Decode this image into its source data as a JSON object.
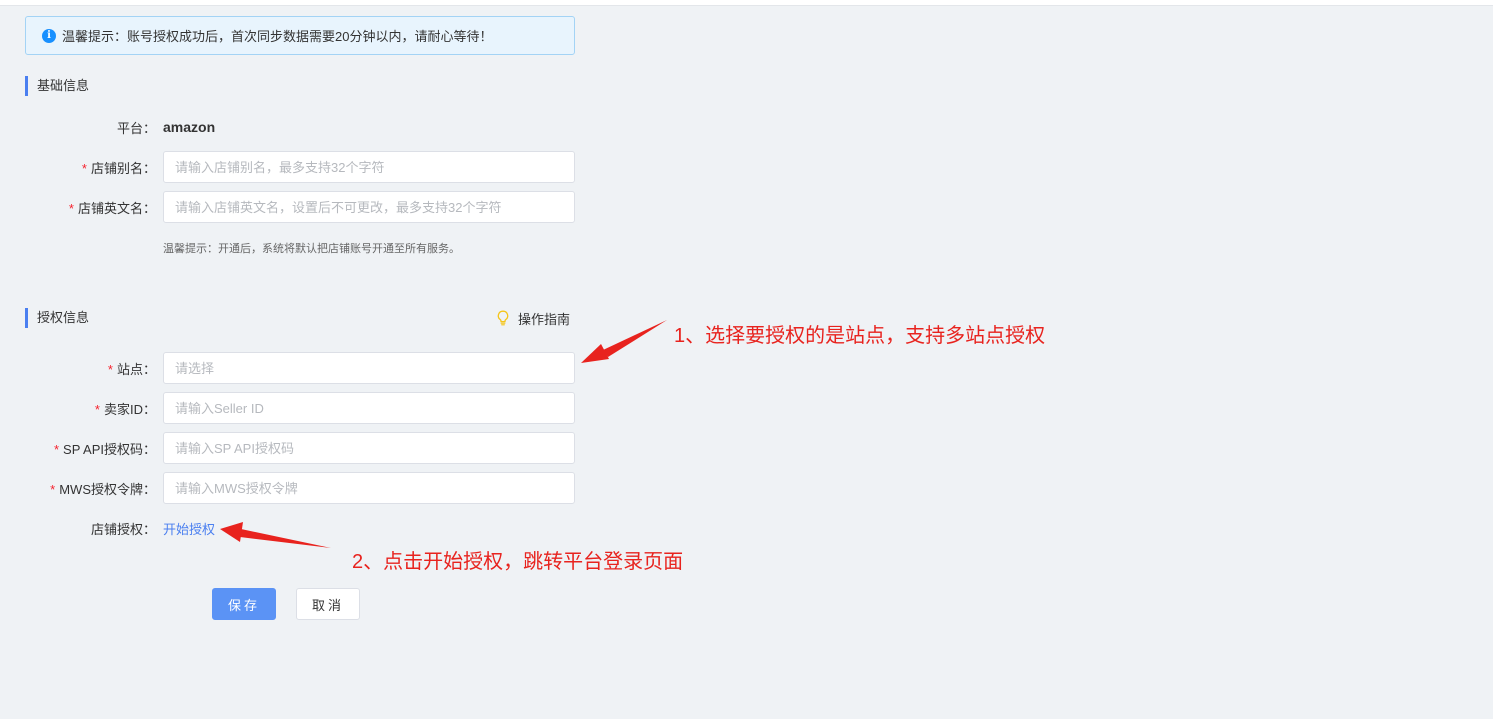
{
  "notice": {
    "text": "温馨提示：账号授权成功后，首次同步数据需要20分钟以内，请耐心等待！"
  },
  "basic": {
    "title": "基础信息",
    "platform_label": "平台：",
    "platform_value": "amazon",
    "shop_alias_label": "店铺别名：",
    "shop_alias_placeholder": "请输入店铺别名，最多支持32个字符",
    "shop_en_label": "店铺英文名：",
    "shop_en_placeholder": "请输入店铺英文名，设置后不可更改，最多支持32个字符",
    "hint": "温馨提示：开通后，系统将默认把店铺账号开通至所有服务。"
  },
  "auth": {
    "title": "授权信息",
    "guide_label": "操作指南",
    "site_label": "站点：",
    "site_placeholder": "请选择",
    "seller_label": "卖家ID：",
    "seller_placeholder": "请输入Seller ID",
    "spapi_label": "SP API授权码：",
    "spapi_placeholder": "请输入SP API授权码",
    "mws_label": "MWS授权令牌：",
    "mws_placeholder": "请输入MWS授权令牌",
    "shop_auth_label": "店铺授权：",
    "shop_auth_link": "开始授权"
  },
  "required_mark": "*",
  "buttons": {
    "save": "保存",
    "cancel": "取消"
  },
  "annotations": {
    "step1": "1、选择要授权的是站点，支持多站点授权",
    "step2": "2、点击开始授权，跳转平台登录页面"
  },
  "colors": {
    "accent": "#4a7ff0",
    "primary_button": "#5b93f5",
    "required": "#f5222d",
    "annotation": "#e8231e"
  }
}
